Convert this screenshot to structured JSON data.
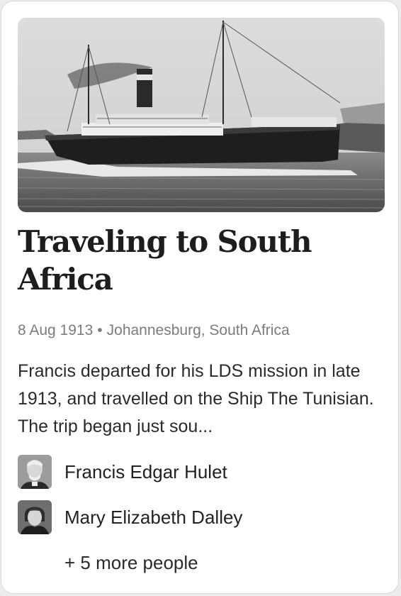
{
  "story": {
    "title": "Traveling to South Africa",
    "date": "8 Aug 1913",
    "separator": "•",
    "location": "Johannesburg, South Africa",
    "description": "Francis departed for his LDS mission in late 1913, and travelled on the Ship The Tunisian. The trip began just sou...",
    "people": [
      {
        "name": "Francis Edgar Hulet"
      },
      {
        "name": "Mary Elizabeth Dalley"
      }
    ],
    "more_people": "+ 5 more people"
  }
}
